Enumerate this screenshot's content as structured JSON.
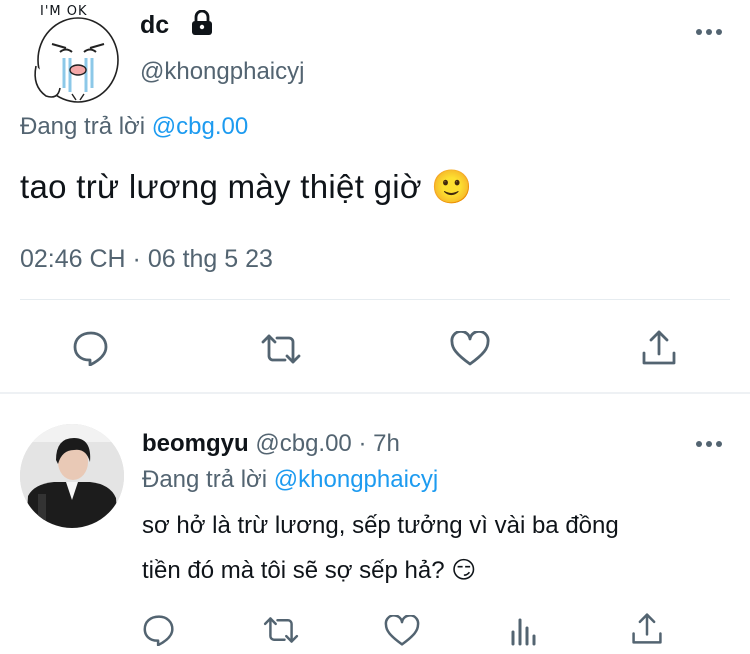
{
  "main_tweet": {
    "display_name": "dc",
    "handle": "@khongphaicyj",
    "avatar_caption": "I'M OK",
    "reply_prefix": "Đang trả lời",
    "reply_to": "@cbg.00",
    "text": "tao trừ lương mày thiệt giờ 🙂",
    "timestamp": "02:46 CH · 06 thg 5 23",
    "icons": [
      "lock-icon",
      "more-icon",
      "reply-icon",
      "retweet-icon",
      "like-icon",
      "share-icon"
    ]
  },
  "reply_tweet": {
    "display_name": "beomgyu",
    "handle": "@cbg.00",
    "time": "· 7h",
    "reply_prefix": "Đang trả lời",
    "reply_to": "@khongphaicyj",
    "text_line1": "sơ hở là trừ lương, sếp tưởng vì vài ba đồng",
    "text_line2": "tiền đó mà tôi sẽ sợ sếp hả? 😏",
    "icons": [
      "more-icon",
      "reply-icon",
      "retweet-icon",
      "like-icon",
      "analytics-icon",
      "share-icon"
    ]
  },
  "colors": {
    "text": "#0f1419",
    "muted": "#536471",
    "link": "#1d9bf0",
    "divider": "#e6ecf0"
  }
}
